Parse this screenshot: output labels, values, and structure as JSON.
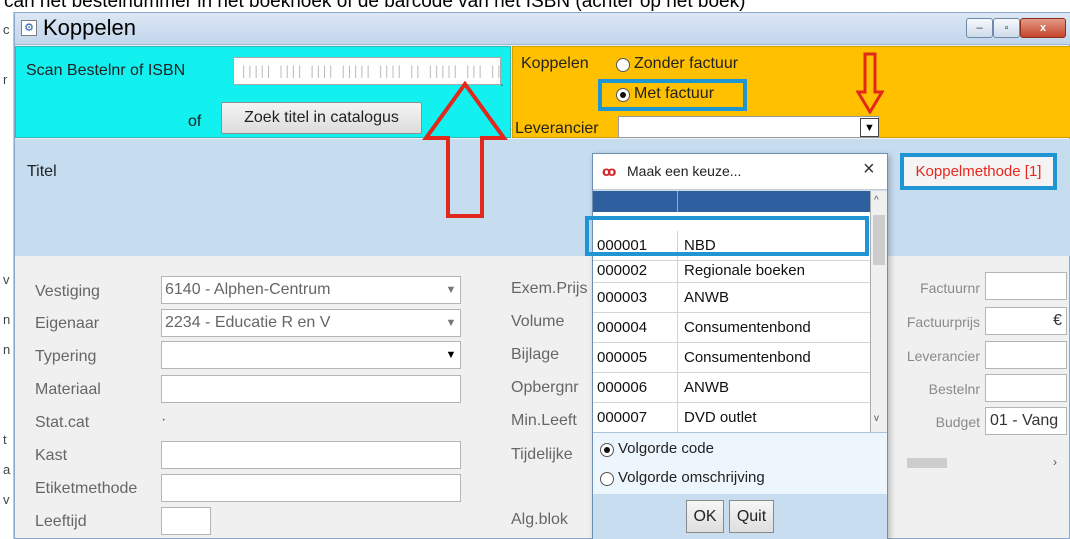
{
  "caption": "can het bestelnummer in het boekhoek of de barcode van het ISBN (achter op het boek)",
  "window": {
    "title": "Koppelen",
    "buttons": {
      "minimize": "–",
      "maximize": "▫",
      "close": "x"
    }
  },
  "scan": {
    "label": "Scan Bestelnr of ISBN",
    "barcode_placeholder": "||||| |||| |||| ||||| |||| || ||||| ||| || |||| ||||",
    "or_label": "of",
    "zoek_button": "Zoek titel in catalogus"
  },
  "koppelen": {
    "label": "Koppelen",
    "option_zonder": "Zonder factuur",
    "option_met": "Met factuur",
    "selected": "Met factuur",
    "leverancier_label": "Leverancier",
    "leverancier_value": ""
  },
  "titel": {
    "label": "Titel",
    "koppelmethode_button": "Koppelmethode [1]"
  },
  "form": {
    "vestiging": {
      "label": "Vestiging",
      "value": "6140 - Alphen-Centrum"
    },
    "eigenaar": {
      "label": "Eigenaar",
      "value": "2234 - Educatie R en V"
    },
    "typering": {
      "label": "Typering",
      "value": ""
    },
    "materiaal": {
      "label": "Materiaal",
      "value": ""
    },
    "statcat": {
      "label": "Stat.cat",
      "value": "·"
    },
    "kast": {
      "label": "Kast",
      "value": ""
    },
    "etiketmethode": {
      "label": "Etiketmethode",
      "value": ""
    },
    "leeftijd": {
      "label": "Leeftijd",
      "value": ""
    },
    "middle_labels": [
      "Exem.Prijs",
      "Volume",
      "Bijlage",
      "Opbergnr",
      "Min.Leeft",
      "Tijdelijke",
      "Alg.blok"
    ]
  },
  "right": {
    "factuurnr": {
      "label": "Factuurnr",
      "value": ""
    },
    "factuurprijs": {
      "label": "Factuurprijs",
      "value": "€"
    },
    "leverancier": {
      "label": "Leverancier",
      "value": ""
    },
    "bestelnr": {
      "label": "Bestelnr",
      "value": ""
    },
    "budget": {
      "label": "Budget",
      "value": "01 - Vang"
    }
  },
  "popup": {
    "title": "Maak een keuze...",
    "logo": "ꝏ",
    "rows": [
      {
        "code": "000001",
        "name": "NBD"
      },
      {
        "code": "000002",
        "name": "Regionale boeken"
      },
      {
        "code": "000003",
        "name": "ANWB"
      },
      {
        "code": "000004",
        "name": "Consumentenbond"
      },
      {
        "code": "000005",
        "name": "Consumentenbond"
      },
      {
        "code": "000006",
        "name": "ANWB"
      },
      {
        "code": "000007",
        "name": "DVD outlet"
      }
    ],
    "selected_code": "000001",
    "sort_code": "Volgorde code",
    "sort_omschrijving": "Volgorde omschrijving",
    "sort_selected": "Volgorde code",
    "ok": "OK",
    "quit": "Quit"
  },
  "colors": {
    "scan_panel": "#13f0f0",
    "koppelen_panel": "#ffc000",
    "title_band": "#c6ddf0",
    "highlight_box": "#1f95d4",
    "annotation_arrow": "#e0281c",
    "koppelmethode_text": "#e8271c"
  }
}
